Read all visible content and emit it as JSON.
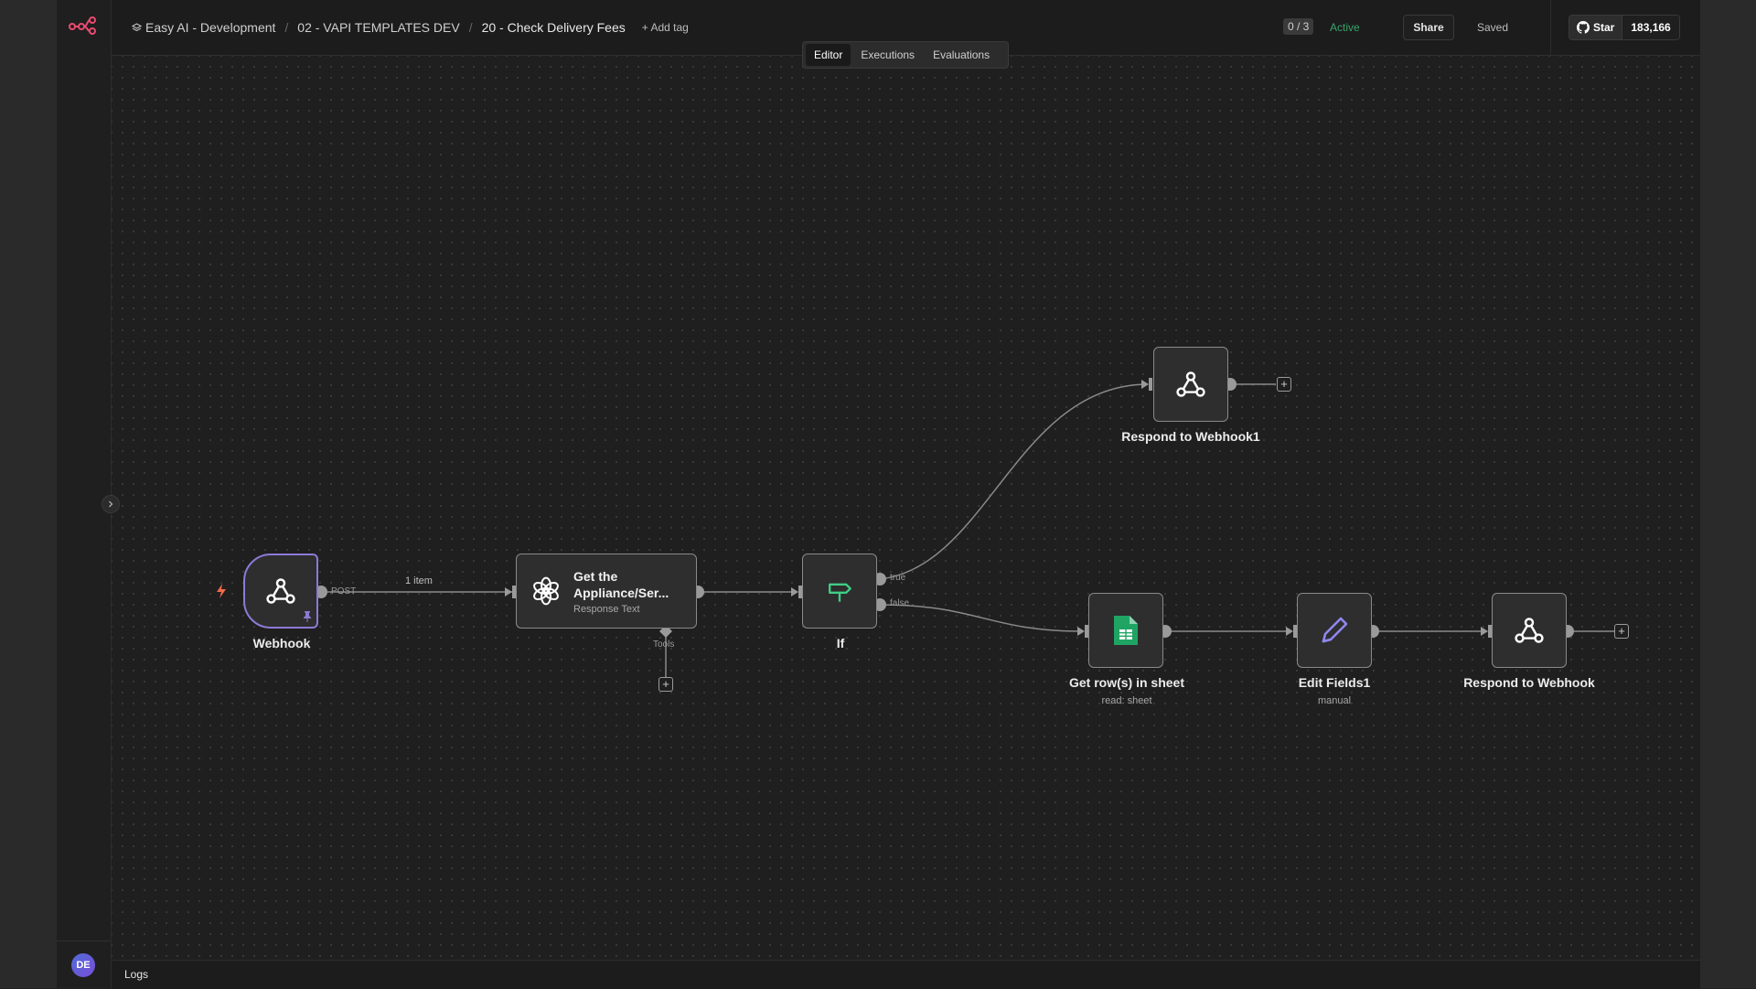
{
  "header": {
    "project": "Easy AI - Development",
    "folder": "02 - VAPI TEMPLATES DEV",
    "workflow": "20 - Check Delivery Fees",
    "add_tag": "+ Add tag",
    "counter": "0 / 3",
    "status": "Active",
    "share": "Share",
    "saved": "Saved",
    "github_star": "Star",
    "github_count": "183,166"
  },
  "tabs": [
    "Editor",
    "Executions",
    "Evaluations"
  ],
  "active_tab": "Editor",
  "nodes": {
    "webhook": {
      "label": "Webhook"
    },
    "openai": {
      "title": "Get the Appliance/Ser...",
      "subtitle": "Response Text"
    },
    "if": {
      "label": "If"
    },
    "respond1": {
      "label": "Respond to Webhook1"
    },
    "sheets": {
      "label": "Get row(s) in sheet",
      "subtitle": "read: sheet"
    },
    "edit": {
      "label": "Edit Fields1",
      "subtitle": "manual"
    },
    "respond": {
      "label": "Respond to Webhook"
    }
  },
  "edges": {
    "webhook_output": "POST",
    "item_count": "1 item",
    "tools_port": "Tools",
    "if_true": "true",
    "if_false": "false"
  },
  "user": {
    "initials": "DE"
  },
  "logs": {
    "label": "Logs"
  },
  "colors": {
    "accent": "#ea4b71",
    "active": "#39a46b",
    "trigger_border": "#8d7ad6",
    "sheets_green": "#1fa463",
    "edit_purple": "#8f87f1"
  }
}
